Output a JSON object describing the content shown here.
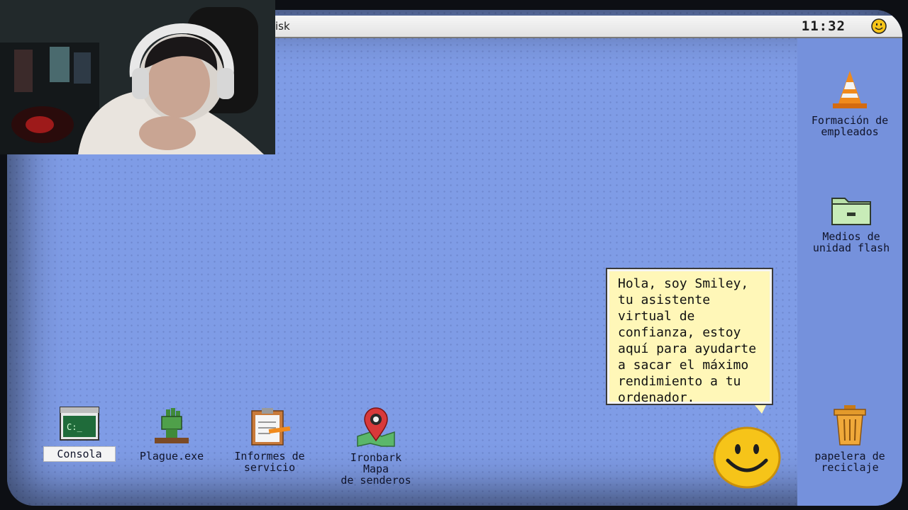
{
  "menubar": {
    "menu_label": "isk",
    "clock": "11:32"
  },
  "bubble": {
    "text": "Hola, soy Smiley, tu asistente virtual de confianza, estoy aquí para ayudarte a sacar el máximo rendimiento a tu ordenador."
  },
  "desktop": {
    "bottom_icons": [
      {
        "label": "Consola"
      },
      {
        "label": "Plague.exe"
      },
      {
        "label": "Informes de\nservicio"
      },
      {
        "label": "Ironbark\nMapa\nde senderos"
      }
    ],
    "right_icons": [
      {
        "label": "Formación de\nempleados"
      },
      {
        "label": "Medios de\nunidad flash"
      },
      {
        "label": "papelera de\nreciclaje"
      }
    ]
  },
  "colors": {
    "desktop": "#7f9ce6",
    "bubble": "#fff7b8",
    "smiley": "#f6c419"
  }
}
